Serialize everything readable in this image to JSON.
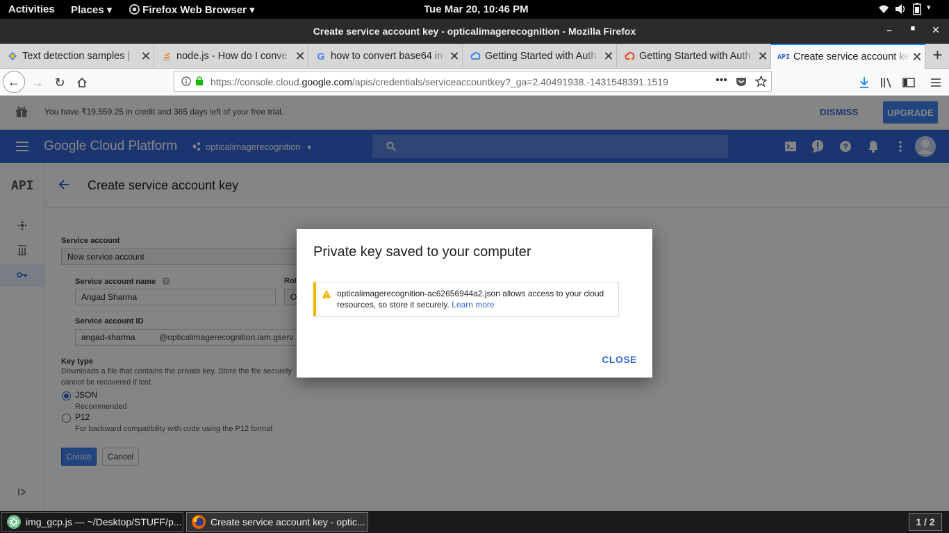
{
  "system": {
    "activities": "Activities",
    "places": "Places",
    "app_menu": "Firefox Web Browser",
    "clock": "Tue Mar 20, 10:46 PM"
  },
  "window": {
    "title": "Create service account key - opticalimagerecognition - Mozilla Firefox"
  },
  "tabs": [
    {
      "label": "Text detection samples  |",
      "favicon": "gcp-icon"
    },
    {
      "label": "node.js - How do I conve",
      "favicon": "stackoverflow-icon"
    },
    {
      "label": "how to convert base64 in",
      "favicon": "google-icon"
    },
    {
      "label": "Getting Started with Auth",
      "favicon": "gcp-icon"
    },
    {
      "label": "Getting Started with Auth",
      "favicon": "gcp-icon"
    },
    {
      "label": "Create service account ke",
      "favicon": "api-icon",
      "favicon_text": "API"
    }
  ],
  "urlbar": {
    "url_prefix": "https://console.cloud.",
    "url_domain": "google.com",
    "url_suffix": "/apis/credentials/serviceaccountkey?_ga=2.40491938.-1431548391.1519"
  },
  "trial_banner": {
    "message": "You have ₹19,559.25 in credit and 365 days left of your free trial.",
    "dismiss": "DISMISS",
    "upgrade": "UPGRADE"
  },
  "gcp_header": {
    "logo": "Google Cloud Platform",
    "project": "opticalimagerecognition"
  },
  "sidenav": {
    "logo": "API"
  },
  "page": {
    "title": "Create service account key"
  },
  "form": {
    "service_account_label": "Service account",
    "service_account_value": "New service account",
    "name_label": "Service account name",
    "name_value": "Angad Sharma",
    "role_label": "Rol",
    "role_value": "O",
    "id_label": "Service account ID",
    "id_value": "angad-sharma",
    "id_domain": "@opticalimagerecognition.iam.gserv",
    "key_type_label": "Key type",
    "key_type_help_1": "Downloads a file that contains the private key. Store the file securely",
    "key_type_help_2": "cannot be recovered if lost.",
    "json_label": "JSON",
    "json_sub": "Recommended",
    "p12_label": "P12",
    "p12_sub": "For backward compatibility with code using the P12 format",
    "create": "Create",
    "cancel": "Cancel",
    "selected_key_type": "JSON"
  },
  "dialog": {
    "title": "Private key saved to your computer",
    "warning_text": "opticalimagerecognition-ac62656944a2.json allows access to your cloud resources, so store it securely.",
    "learn_more": "Learn more",
    "close": "CLOSE"
  },
  "taskbar": {
    "items": [
      {
        "label": "img_gcp.js — ~/Desktop/STUFF/p..."
      },
      {
        "label": "Create service account key - optic..."
      }
    ],
    "pager": "1 / 2"
  },
  "colors": {
    "gcp_blue": "#3367d6",
    "accent": "#4285f4",
    "warning": "#f4b400"
  }
}
